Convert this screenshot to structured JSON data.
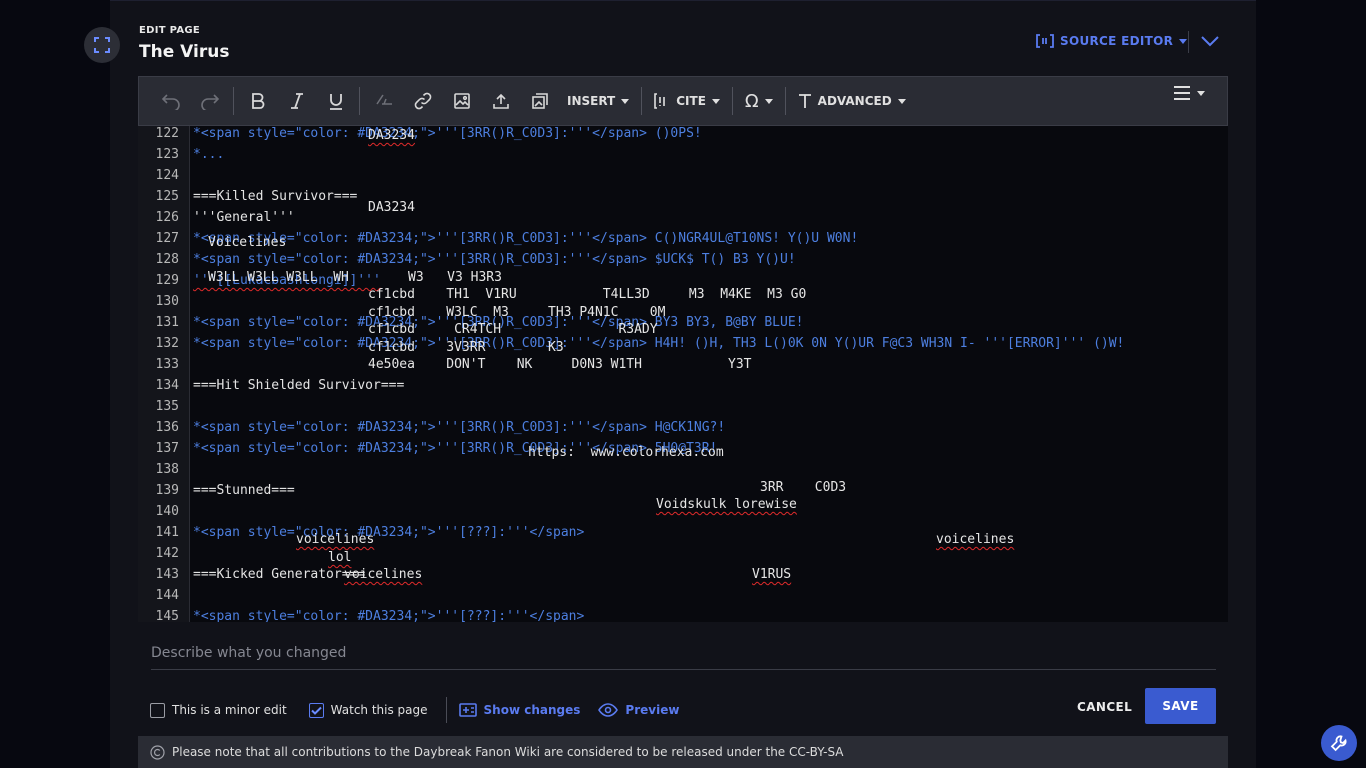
{
  "header": {
    "eyebrow": "EDIT PAGE",
    "title": "The Virus",
    "source_editor_label": "SOURCE EDITOR"
  },
  "toolbar": {
    "insert_label": "INSERT",
    "cite_label": "CITE",
    "advanced_label": "ADVANCED"
  },
  "editor": {
    "line_numbers": [
      "122",
      "123",
      "124",
      "125",
      "126",
      "127",
      "128",
      "129",
      "130",
      "131",
      "132",
      "133",
      "134",
      "135",
      "136",
      "137",
      "138",
      "139",
      "140",
      "141",
      "142",
      "143",
      "144",
      "145"
    ],
    "lines": {
      "l122": "*<span style=\"color: #DA3234;\">'''[3RR()R_C0D3]:'''</span> ()0PS!",
      "l123": "*...",
      "l125": "===Killed Survivor===",
      "l126": "'''General'''",
      "l127": "*<span style=\"color: #DA3234;\">'''[3RR()R_C0D3]:'''</span> C()NGR4UL@T10NS! Y()U W0N!",
      "l128": "*<span style=\"color: #DA3234;\">'''[3RR()R_C0D3]:'''</span> $UCK$ T() B3 Y()U!",
      "l129": "'''[[Lukacbashlongi]]'''",
      "l131": "*<span style=\"color: #DA3234;\">'''[3RR()R_C0D3]:'''</span> BY3 BY3, B@BY BLUE!",
      "l132": "*<span style=\"color: #DA3234;\">'''[3RR()R_C0D3]:'''</span> H4H! ()H, TH3 L()0K 0N Y()UR F@C3 WH3N I- '''[ERROR]''' ()W!",
      "l134": "===Hit Shielded Survivor===",
      "l136": "*<span style=\"color: #DA3234;\">'''[3RR()R_C0D3]:'''</span> H@CK1NG?!",
      "l137": "*<span style=\"color: #DA3234;\">'''[3RR()R_C0D3]:'''</span> 5H0@T3R!",
      "l139": "===Stunned===",
      "l141": "*<span style=\"color: #DA3234;\">'''[???]:'''</span>",
      "l143": "===Kicked Generator===",
      "l145": "*<span style=\"color: #DA3234;\">'''[???]:'''</span>"
    },
    "overlay": {
      "o1": "DA3234",
      "o2": "DA3234",
      "o3": "Voicelines",
      "o4": "W3LL W3LL W3LL  WH",
      "o5": "W3   V3 H3R3",
      "o6": "cf1cbd    TH1  V1RU           T4LL3D     M3  M4KE  M3 G0",
      "o7": "cf1cbd    W3LC  M3     TH3 P4N1C    0M",
      "o8": "cf1cbd     CR4TCH               R3ADY",
      "o9": "cf1cbd    3V3RR        K3",
      "o10": "4e50ea    DON'T    NK     D0N3 W1TH           Y3T",
      "o11": "https:  www.colorhexa.com",
      "o12": "3RR    C0D3",
      "o13": "Voidskulk lorewise",
      "o14": "voicelines",
      "o15": "voicelines",
      "o16": "lol",
      "o17": "voicelines",
      "o18": "V1RUS"
    }
  },
  "footer": {
    "summary_placeholder": "Describe what you changed",
    "minor_edit_label": "This is a minor edit",
    "watch_label": "Watch this page",
    "show_changes_label": "Show changes",
    "preview_label": "Preview",
    "cancel_label": "CANCEL",
    "save_label": "SAVE",
    "license_text": "Please note that all contributions to the Daybreak Fanon Wiki are considered to be released under the CC-BY-SA"
  },
  "colors": {
    "accent": "#3a5bd0",
    "link": "#5a7bf0",
    "markup": "#4d7fe0",
    "spellcheck": "#e02b2b"
  },
  "icons": [
    "expand-icon",
    "undo-icon",
    "redo-icon",
    "bold-icon",
    "italic-icon",
    "underline-icon",
    "clear-formatting-icon",
    "link-icon",
    "image-icon",
    "upload-icon",
    "gallery-icon",
    "cite-icon",
    "special-characters-icon",
    "text-style-icon",
    "hamburger-icon",
    "chevron-down-icon",
    "diff-icon",
    "eye-icon",
    "copyright-icon",
    "wrench-icon"
  ]
}
